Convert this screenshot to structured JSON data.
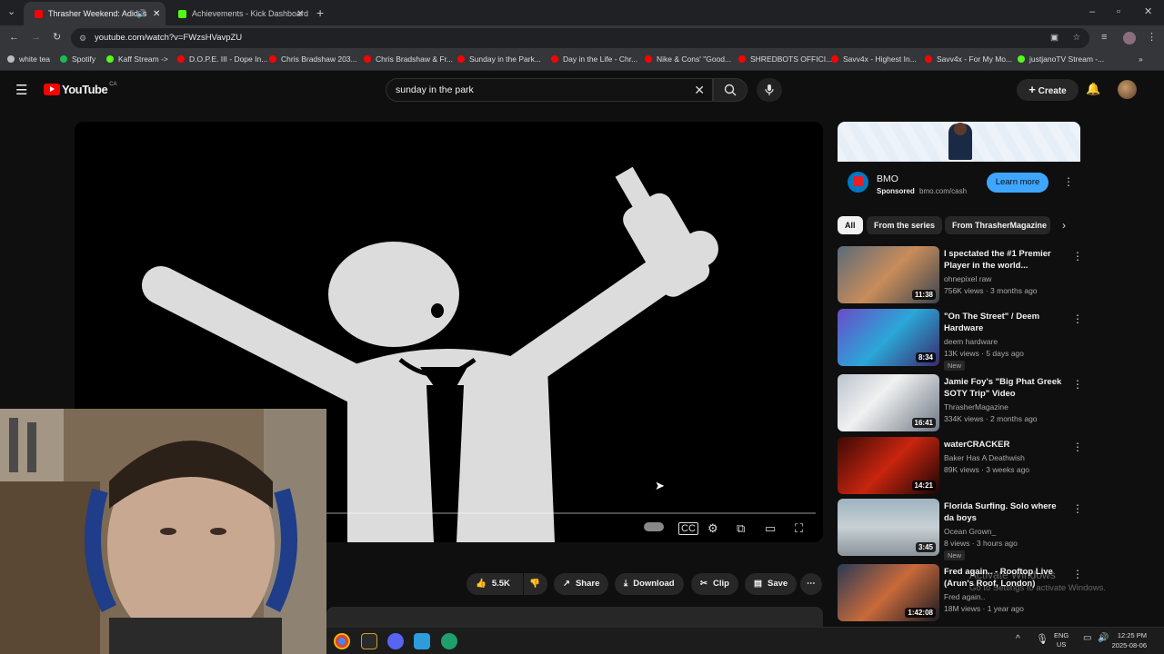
{
  "browser": {
    "tabs": [
      {
        "title": "Thrasher Weekend: Adidas",
        "active": true,
        "icon": "youtube-icon"
      },
      {
        "title": "Achievements - Kick Dashboard",
        "active": false,
        "icon": "kick-icon"
      }
    ],
    "new_tab": "+",
    "url": "youtube.com/watch?v=FWzsHVavpZU",
    "bookmarks": [
      {
        "label": "white tea",
        "color": "#bbbbbb"
      },
      {
        "label": "Spotify",
        "color": "#1db954"
      },
      {
        "label": "Kaff Stream ->",
        "color": "#53fc18"
      },
      {
        "label": "D.O.P.E. III - Dope In...",
        "color": "#ff0000"
      },
      {
        "label": "Chris Bradshaw 203...",
        "color": "#ff0000"
      },
      {
        "label": "Chris Bradshaw & Fr...",
        "color": "#ff0000"
      },
      {
        "label": "Sunday in the Park...",
        "color": "#ff0000"
      },
      {
        "label": "Day in the Life - Chr...",
        "color": "#ff0000"
      },
      {
        "label": "Nike & Cons' \"Good...",
        "color": "#ff0000"
      },
      {
        "label": "SHREDBOTS OFFICI...",
        "color": "#ff0000"
      },
      {
        "label": "Savv4x - Highest In...",
        "color": "#ff0000"
      },
      {
        "label": "Savv4x - For My Mo...",
        "color": "#ff0000"
      },
      {
        "label": "justjanoTV Stream -...",
        "color": "#53fc18"
      }
    ]
  },
  "youtube": {
    "logo": "YouTube",
    "region": "CA",
    "search_query": "sunday in the park",
    "create_label": "Create",
    "actions": {
      "likes": "5.5K",
      "share": "Share",
      "download": "Download",
      "clip": "Clip",
      "save": "Save"
    },
    "ad": {
      "name": "BMO",
      "sponsored": "Sponsored",
      "domain": "bmo.com/cash",
      "cta": "Learn more"
    },
    "chips": [
      "All",
      "From the series",
      "From ThrasherMagazine"
    ],
    "recommendations": [
      {
        "title": "I spectated the #1 Premier Player in the world...",
        "channel": "ohnepixel raw",
        "meta": "756K views · 3 months ago",
        "duration": "11:38",
        "badge": ""
      },
      {
        "title": "\"On The Street\" / Deem Hardware",
        "channel": "deem hardware",
        "meta": "13K views · 5 days ago",
        "duration": "8:34",
        "badge": "New"
      },
      {
        "title": "Jamie Foy's \"Big Phat Greek SOTY Trip\" Video",
        "channel": "ThrasherMagazine",
        "meta": "334K views · 2 months ago",
        "duration": "16:41",
        "badge": ""
      },
      {
        "title": "waterCRACKER",
        "channel": "Baker Has A Deathwish",
        "meta": "89K views · 3 weeks ago",
        "duration": "14:21",
        "badge": ""
      },
      {
        "title": "Florida Surfing. Solo where da boys",
        "channel": "Ocean Grown_",
        "meta": "8 views · 3 hours ago",
        "duration": "3:45",
        "badge": "New"
      },
      {
        "title": "Fred again.. - Rooftop Live (Arun's Roof, London)",
        "channel": "Fred again..",
        "meta": "18M views · 1 year ago",
        "duration": "1:42:08",
        "badge": ""
      }
    ]
  },
  "windows": {
    "activate_title": "Activate Windows",
    "activate_sub": "Go to Settings to activate Windows.",
    "lang": "ENG",
    "region": "US",
    "time": "12:25 PM",
    "date": "2025-08-06"
  }
}
